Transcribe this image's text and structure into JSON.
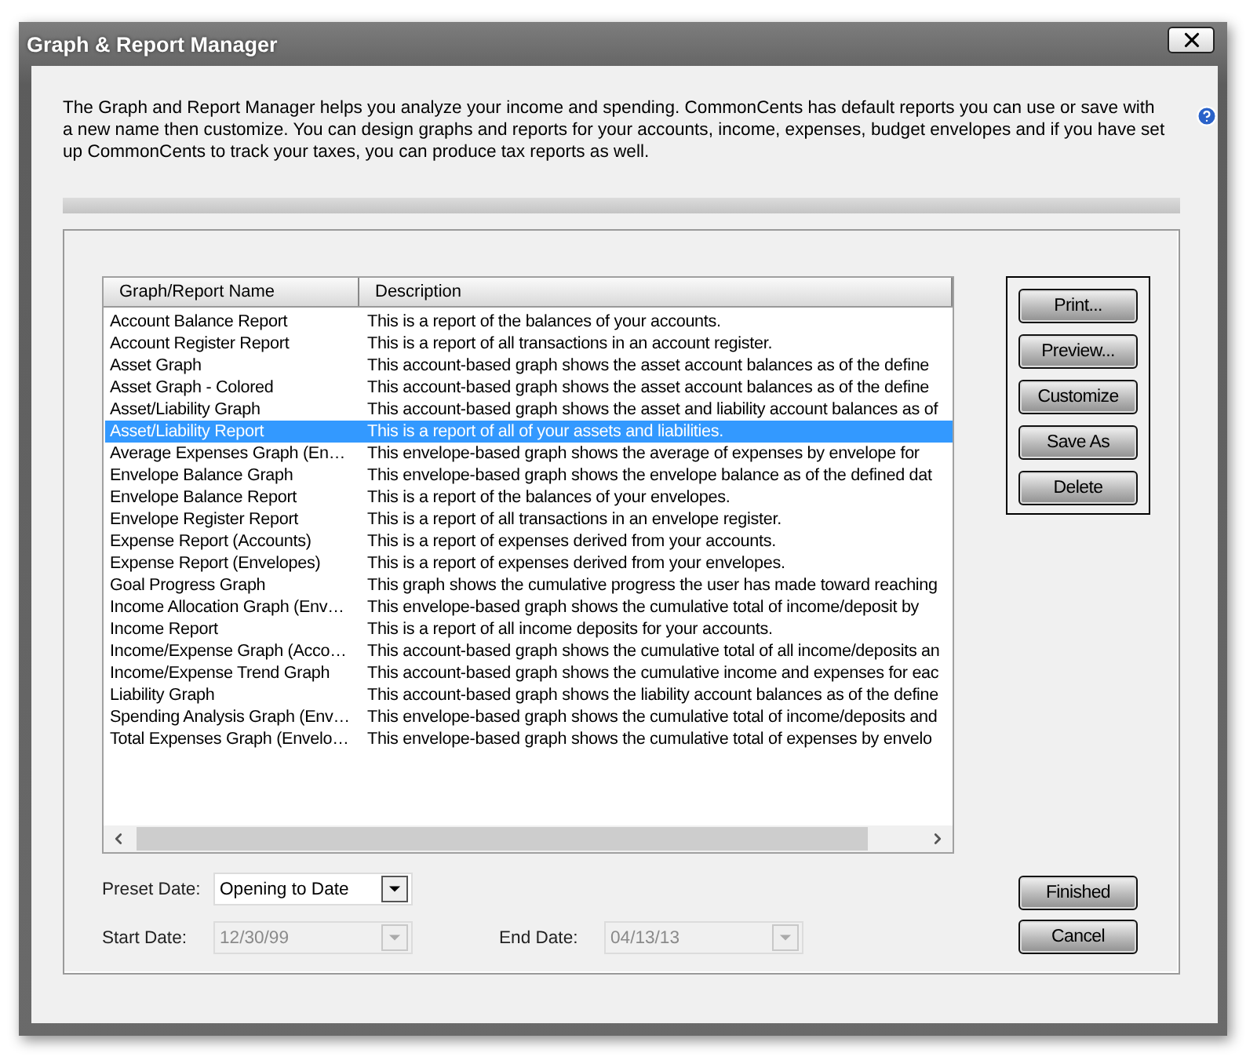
{
  "window": {
    "title": "Graph & Report Manager"
  },
  "intro": "The Graph and Report Manager helps you analyze your income and spending. CommonCents has default reports you can use or save with a new name then customize. You can design graphs and reports for your accounts, income, expenses, budget envelopes and if you have set up CommonCents to track your taxes, you can produce tax reports as well.",
  "table": {
    "columns": [
      "Graph/Report Name",
      "Description"
    ],
    "rows": [
      {
        "name": "Account Balance Report",
        "description": "This is a report of the balances of your accounts.",
        "selected": false
      },
      {
        "name": "Account Register Report",
        "description": "This is a report of all transactions in an account register.",
        "selected": false
      },
      {
        "name": "Asset Graph",
        "description": "This account-based graph shows the asset account balances as of the define",
        "selected": false
      },
      {
        "name": "Asset Graph - Colored",
        "description": "This account-based graph shows the asset account balances as of the define",
        "selected": false
      },
      {
        "name": "Asset/Liability Graph",
        "description": "This account-based graph shows the asset and liability account balances as of",
        "selected": false
      },
      {
        "name": "Asset/Liability Report",
        "description": "This is a report of all of your assets and liabilities.",
        "selected": true
      },
      {
        "name": "Average Expenses Graph (En…",
        "description": "This envelope-based graph shows the average of expenses by envelope for",
        "selected": false
      },
      {
        "name": "Envelope Balance Graph",
        "description": "This envelope-based graph shows the envelope balance as of the defined dat",
        "selected": false
      },
      {
        "name": "Envelope Balance Report",
        "description": "This is a report of the balances of your envelopes.",
        "selected": false
      },
      {
        "name": "Envelope Register Report",
        "description": "This is a report of all transactions in an envelope register.",
        "selected": false
      },
      {
        "name": "Expense Report (Accounts)",
        "description": "This is a report of expenses derived from your accounts.",
        "selected": false
      },
      {
        "name": "Expense Report (Envelopes)",
        "description": "This is a report of expenses derived from your envelopes.",
        "selected": false
      },
      {
        "name": "Goal Progress Graph",
        "description": "This graph shows the cumulative progress the user has made toward reaching",
        "selected": false
      },
      {
        "name": "Income Allocation Graph (Env…",
        "description": "This envelope-based graph shows the cumulative total of income/deposit by",
        "selected": false
      },
      {
        "name": "Income Report",
        "description": "This is a report of all income deposits for your accounts.",
        "selected": false
      },
      {
        "name": "Income/Expense Graph (Acco…",
        "description": "This account-based graph shows the cumulative total of all income/deposits an",
        "selected": false
      },
      {
        "name": "Income/Expense Trend Graph",
        "description": "This account-based graph shows the cumulative income and expenses for eac",
        "selected": false
      },
      {
        "name": "Liability Graph",
        "description": "This account-based graph shows the liability account balances as of the define",
        "selected": false
      },
      {
        "name": "Spending Analysis Graph (Env…",
        "description": "This envelope-based graph shows the cumulative total of income/deposits and",
        "selected": false
      },
      {
        "name": "Total Expenses Graph (Envelo…",
        "description": "This envelope-based graph shows the cumulative total of expenses by envelo",
        "selected": false
      }
    ]
  },
  "side_buttons": [
    "Print...",
    "Preview...",
    "Customize",
    "Save As",
    "Delete"
  ],
  "preset_date": {
    "label": "Preset Date:",
    "value": "Opening to Date",
    "disabled": false
  },
  "start_date": {
    "label": "Start Date:",
    "value": "12/30/99",
    "disabled": true
  },
  "end_date": {
    "label": "End Date:",
    "value": "04/13/13",
    "disabled": true
  },
  "footer_buttons": [
    "Finished",
    "Cancel"
  ]
}
